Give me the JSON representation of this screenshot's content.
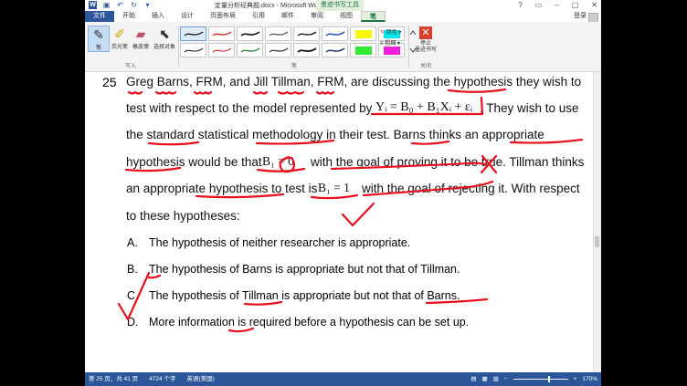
{
  "titlebar": {
    "doc_title": "定量分析经典题.docx - Microsoft Word",
    "context_tab": "墨迹书写工具",
    "word_logo": "W",
    "qat_icons": [
      "save-icon",
      "undo-icon",
      "redo-icon",
      "customize-icon"
    ],
    "window_buttons": [
      "?",
      "▭",
      "–",
      "▢",
      "✕"
    ]
  },
  "menubar": {
    "tabs": [
      "文件",
      "开始",
      "插入",
      "设计",
      "页面布局",
      "引用",
      "邮件",
      "审阅",
      "视图",
      "笔"
    ],
    "active_tab": "笔",
    "login": "登录"
  },
  "ribbon": {
    "write_group": {
      "label": "写入",
      "buttons": [
        {
          "label": "笔",
          "icon": "pen-icon"
        },
        {
          "label": "荧光笔",
          "icon": "highlighter-icon"
        },
        {
          "label": "橡皮擦",
          "icon": "eraser-icon"
        },
        {
          "label": "选择对象",
          "icon": "select-pointer-icon"
        }
      ]
    },
    "pen_group": {
      "label": "笔",
      "color_label": "颜色",
      "thickness_label": "粗细"
    },
    "close_group": {
      "label": "关闭",
      "stop_label_line1": "停止",
      "stop_label_line2": "墨迹书写"
    }
  },
  "document": {
    "question_number": "25",
    "lines": [
      "Greg Barns, FRM, and Jill Tillman, FRM, are discussing the hypothesis they wish to",
      "test with respect to the model represented by",
      ". They wish to use",
      "the standard statistical methodology in their test. Barns thinks an appropriate",
      "hypothesis would be that",
      "with the goal of proving it to be true. Tillman thinks",
      "an appropriate hypothesis to test is",
      "with the goal of rejecting it. With respect",
      "to these hypotheses:"
    ],
    "model_eq": "Yᵢ = B₀ + B₁Xᵢ + εᵢ",
    "barns_eq": "B₁ = 0",
    "tillman_eq": "B₁ = 1",
    "options": [
      {
        "letter": "A.",
        "text": "The hypothesis of neither researcher is appropriate."
      },
      {
        "letter": "B.",
        "text": "The hypothesis of Barns is appropriate but not that of Tillman."
      },
      {
        "letter": "C.",
        "text": "The hypothesis of Tillman is appropriate but not that of Barns."
      },
      {
        "letter": "D.",
        "text": "More information is required before a hypothesis can be set up."
      }
    ]
  },
  "statusbar": {
    "page": "第 25 页，共 41 页",
    "words": "4724 个字",
    "language": "英语(美国)",
    "zoom": "170%"
  },
  "colors": {
    "ink": "#e8101e",
    "word_blue": "#2b579a",
    "pen_tab_green": "#217346"
  }
}
